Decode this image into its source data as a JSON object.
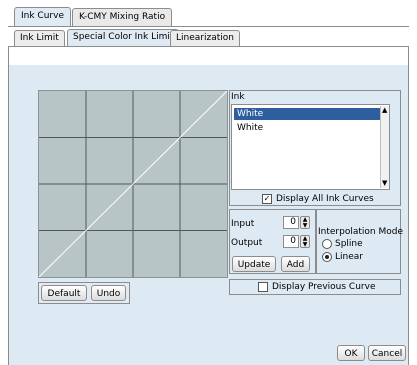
{
  "top_tabs": [
    {
      "label": "Ink Curve",
      "active": true
    },
    {
      "label": "K-CMY Mixing Ratio",
      "active": false
    }
  ],
  "sub_tabs": [
    {
      "label": "Ink Limit",
      "active": false
    },
    {
      "label": "Special Color Ink Limit",
      "active": true
    },
    {
      "label": "Linearization",
      "active": false
    }
  ],
  "curve": {
    "default_label": "Default",
    "undo_label": "Undo"
  },
  "ink": {
    "title": "Ink",
    "items": [
      {
        "label": "White",
        "selected": true
      },
      {
        "label": "White",
        "selected": false
      }
    ],
    "display_all_label": "Display All Ink Curves",
    "display_all_checked": true
  },
  "io": {
    "input_label": "Input",
    "input_value": "0",
    "output_label": "Output",
    "output_value": "0",
    "update_label": "Update",
    "add_label": "Add"
  },
  "interpolation": {
    "title": "Interpolation Mode",
    "options": [
      {
        "label": "Spline",
        "selected": false
      },
      {
        "label": "Linear",
        "selected": true
      }
    ]
  },
  "display_previous_label": "Display Previous Curve",
  "display_previous_checked": false,
  "footer": {
    "ok_label": "OK",
    "cancel_label": "Cancel"
  },
  "colors": {
    "panel": "#dde9f3",
    "curve_bg": "#b7c5c7",
    "selection": "#2f5e9f"
  }
}
